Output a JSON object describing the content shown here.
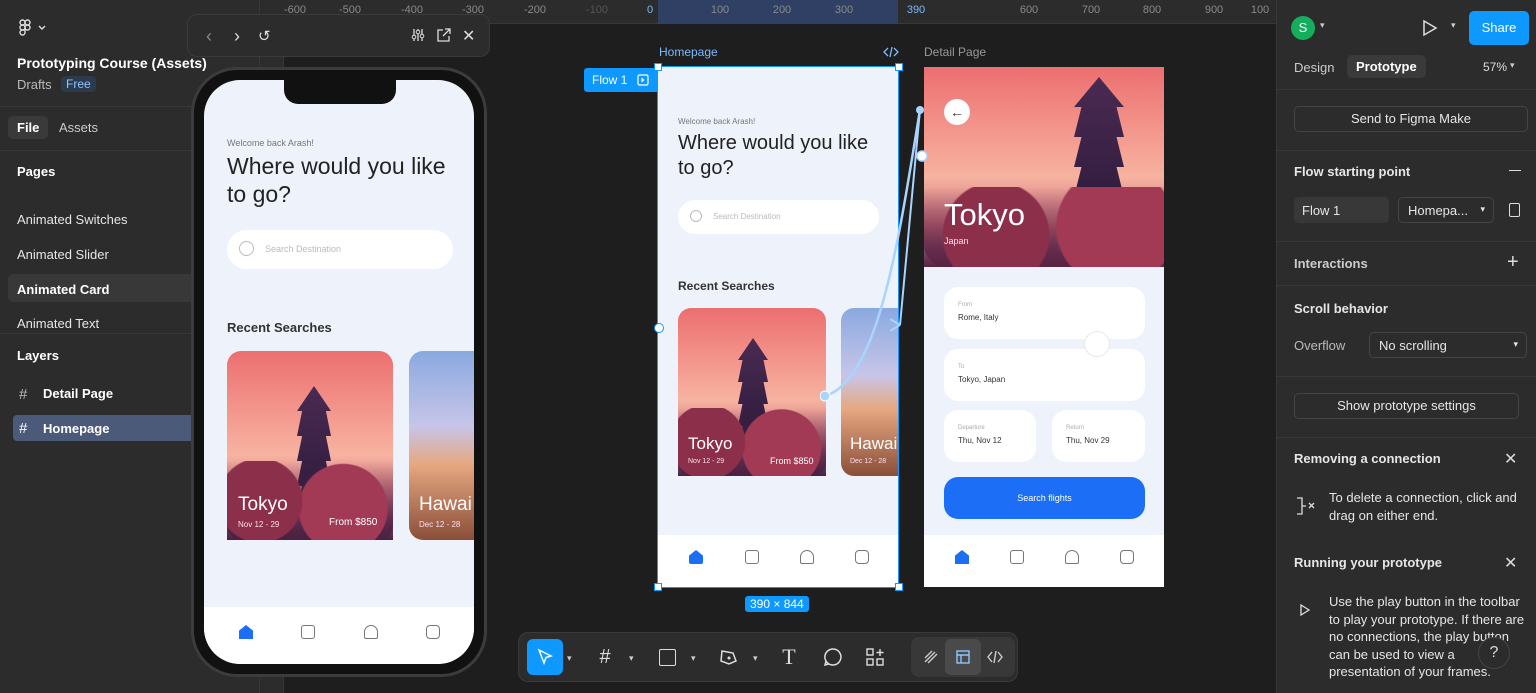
{
  "left_panel": {
    "file_title": "Prototyping Course (Assets)",
    "drafts": "Drafts",
    "plan_badge": "Free",
    "tabs": [
      "File",
      "Assets"
    ],
    "pages_heading": "Pages",
    "pages": [
      "Animated Switches",
      "Animated Slider",
      "Animated Card",
      "Animated Text"
    ],
    "layers_heading": "Layers",
    "layers": [
      "Detail Page",
      "Homepage"
    ]
  },
  "ruler": {
    "ticks": [
      "-600",
      "-500",
      "-400",
      "-300",
      "-200",
      "-100",
      "0",
      "100",
      "200",
      "300",
      "390",
      "600",
      "700",
      "800",
      "900",
      "100"
    ]
  },
  "canvas": {
    "flow_label": "Flow 1",
    "frame1_title": "Homepage",
    "frame2_title": "Detail Page",
    "dimension": "390 × 844"
  },
  "phone": {
    "welcome": "Welcome back Arash!",
    "headline": "Where would you like to go?",
    "search_placeholder": "Search Destination",
    "recent": "Recent Searches",
    "card1_city": "Tokyo",
    "card1_dates": "Nov 12 - 29",
    "card1_price": "From $850",
    "card2_city": "Hawai",
    "card2_dates": "Dec 12 - 28"
  },
  "detail": {
    "city": "Tokyo",
    "country": "Japan",
    "from_label": "From",
    "from_value": "Rome, Italy",
    "to_label": "To",
    "to_value": "Tokyo, Japan",
    "dep_label": "Departure",
    "dep_value": "Thu, Nov 12",
    "ret_label": "Return",
    "ret_value": "Thu, Nov 29",
    "search_button": "Search flights"
  },
  "right_panel": {
    "avatar": "S",
    "share": "Share",
    "tabs": [
      "Design",
      "Prototype"
    ],
    "zoom": "57%",
    "send_to_make": "Send to Figma Make",
    "flow_start": "Flow starting point",
    "flow_name": "Flow 1",
    "flow_target": "Homepa...",
    "interactions": "Interactions",
    "scroll_behavior": "Scroll behavior",
    "overflow_label": "Overflow",
    "overflow_value": "No scrolling",
    "show_settings": "Show prototype settings",
    "removing_title": "Removing a connection",
    "removing_body": "To delete a connection, click and drag on either end.",
    "running_title": "Running your prototype",
    "running_body": "Use the play button in the toolbar to play your prototype. If there are no connections, the play button can be used to view a presentation of your frames.",
    "help": "?"
  },
  "colors": {
    "accent": "#0d99ff",
    "share": "#0d99ff",
    "search_btn": "#1b6ef5",
    "avatar": "#14ae5c"
  }
}
